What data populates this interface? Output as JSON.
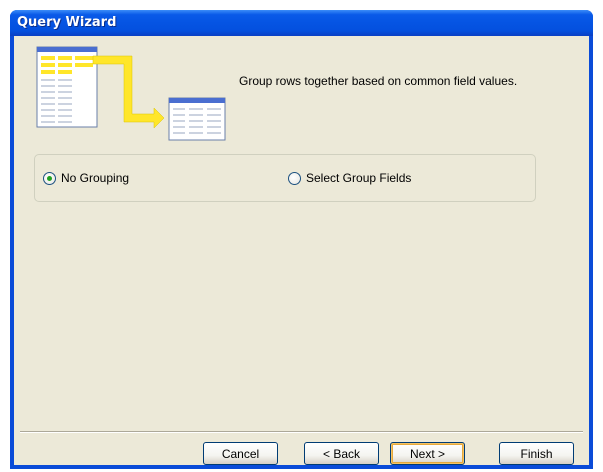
{
  "window": {
    "title": "Query Wizard"
  },
  "main": {
    "description": "Group rows together based on common field values.",
    "grouping_options": [
      {
        "label": "No Grouping",
        "checked": true
      },
      {
        "label": "Select Group Fields",
        "checked": false
      }
    ]
  },
  "buttons": {
    "cancel": "Cancel",
    "back": "< Back",
    "next": "Next >",
    "finish": "Finish"
  },
  "colors": {
    "titlebar": "#0554e3",
    "client_bg": "#ece9d8",
    "radio_checked": "#21a121"
  },
  "icons": [
    "wizard-grouping-graphic"
  ]
}
